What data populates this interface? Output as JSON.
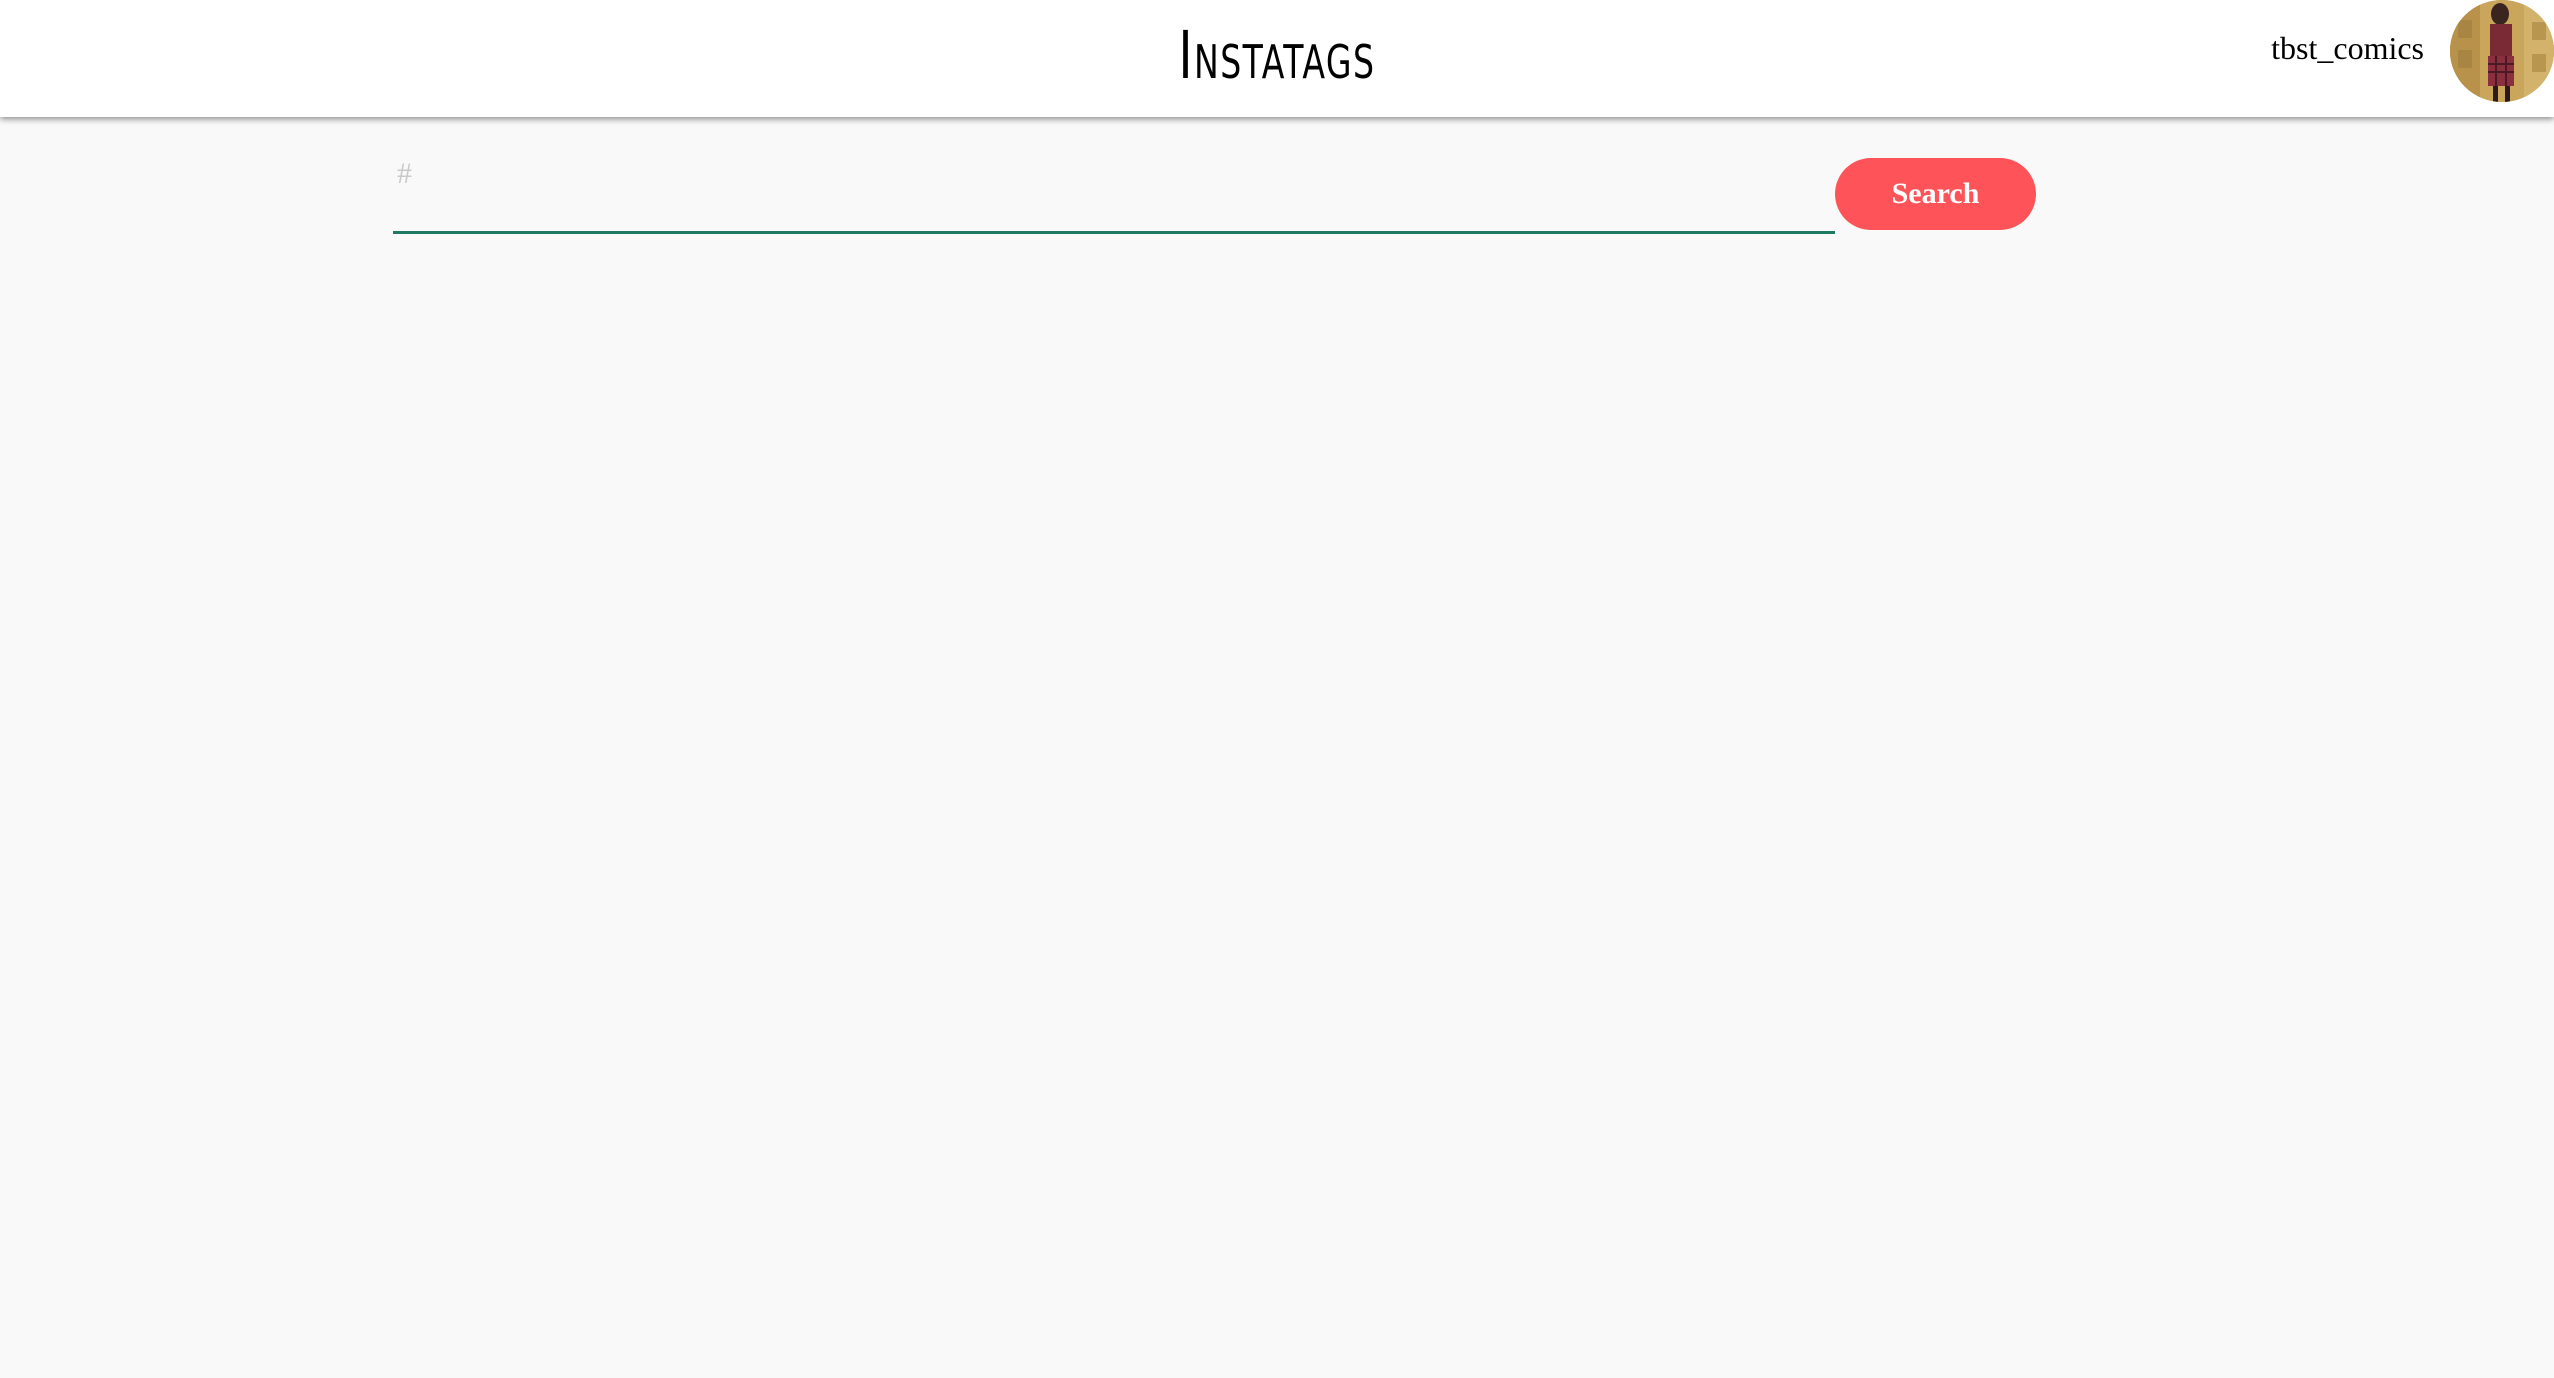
{
  "app": {
    "title": "Instatags"
  },
  "user": {
    "username": "tbst_comics"
  },
  "search": {
    "placeholder": "#",
    "value": "",
    "button_label": "Search"
  },
  "colors": {
    "accent": "#fd5359",
    "underline": "#1f7a64",
    "background": "#f9f9f9"
  }
}
